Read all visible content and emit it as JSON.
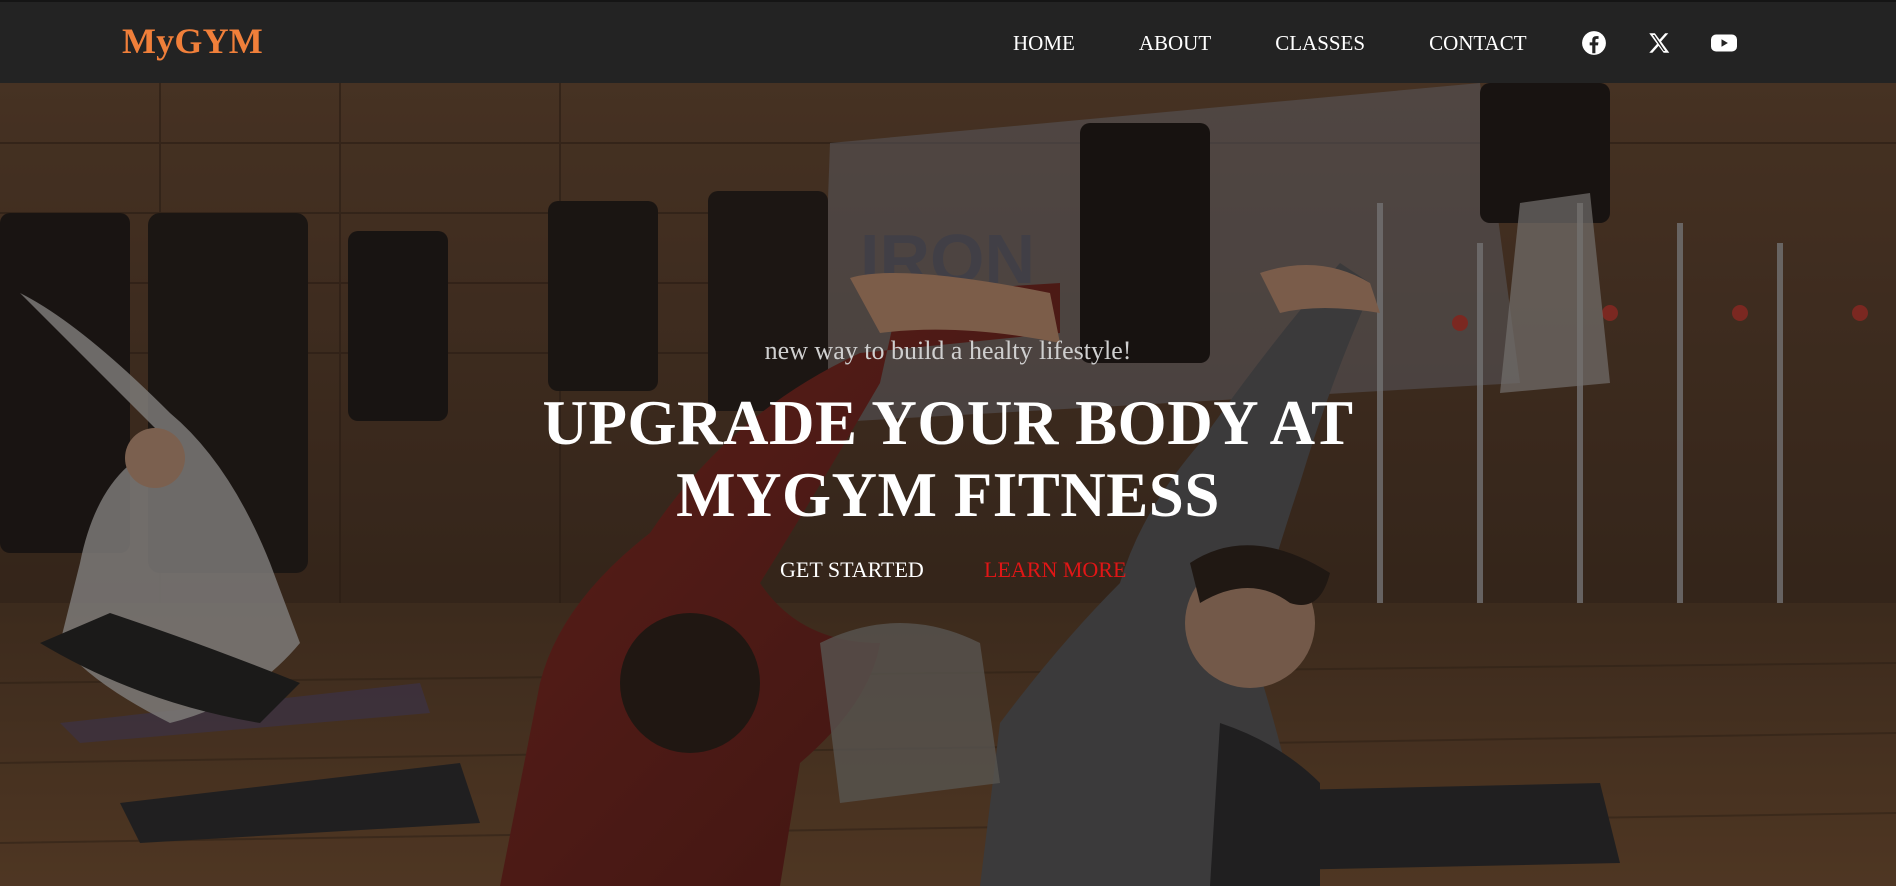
{
  "brand": {
    "name": "MyGYM",
    "color": "#f07f3a"
  },
  "nav": {
    "links": [
      {
        "label": "HOME"
      },
      {
        "label": "ABOUT"
      },
      {
        "label": "CLASSES"
      },
      {
        "label": "CONTACT"
      }
    ],
    "social_icons": [
      "facebook-icon",
      "x-twitter-icon",
      "youtube-icon"
    ]
  },
  "hero": {
    "tagline": "new way to build a healty lifestyle!",
    "headline_line1": "UPGRADE YOUR BODY AT",
    "headline_line2": "MYGYM FITNESS",
    "cta_primary": "GET STARTED",
    "cta_secondary": "LEARN MORE",
    "cta_secondary_color": "#e01616",
    "background_image": "gym-class-stretching-photo"
  }
}
